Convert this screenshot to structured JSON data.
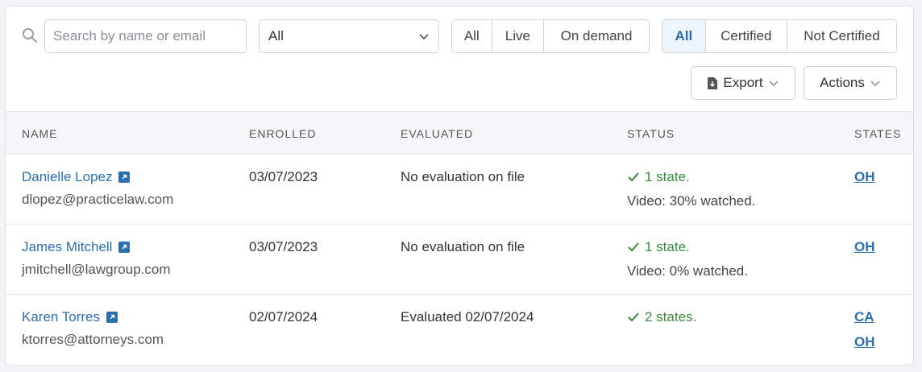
{
  "search": {
    "placeholder": "Search by name or email",
    "icon": "search-icon"
  },
  "filter_select": {
    "value": "All"
  },
  "mode_filter": {
    "options": [
      "All",
      "Live",
      "On demand"
    ]
  },
  "cert_filter": {
    "options": [
      "All",
      "Certified",
      "Not Certified"
    ],
    "active": "All"
  },
  "export_label": "Export",
  "actions_label": "Actions",
  "columns": {
    "name": "NAME",
    "enrolled": "ENROLLED",
    "evaluated": "EVALUATED",
    "status": "STATUS",
    "states": "STATES"
  },
  "rows": [
    {
      "name": "Danielle Lopez",
      "email": "dlopez@practicelaw.com",
      "enrolled": "03/07/2023",
      "evaluated": "No evaluation on file",
      "status": "1 state.",
      "video": "Video: 30% watched.",
      "states": [
        "OH"
      ]
    },
    {
      "name": "James Mitchell",
      "email": "jmitchell@lawgroup.com",
      "enrolled": "03/07/2023",
      "evaluated": "No evaluation on file",
      "status": "1 state.",
      "video": "Video: 0% watched.",
      "states": [
        "OH"
      ]
    },
    {
      "name": "Karen Torres",
      "email": "ktorres@attorneys.com",
      "enrolled": "02/07/2024",
      "evaluated": "Evaluated 02/07/2024",
      "status": "2 states.",
      "video": "",
      "states": [
        "CA",
        "OH"
      ]
    }
  ],
  "colors": {
    "accent": "#2a6fb0",
    "success": "#3a8a3a",
    "active_bg": "#eef4fb"
  }
}
